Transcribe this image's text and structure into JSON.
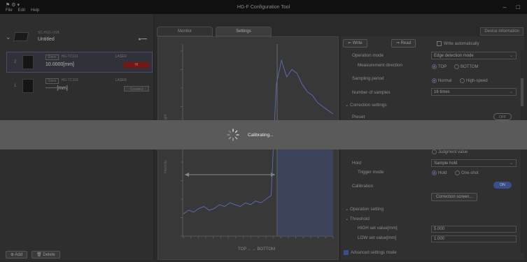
{
  "window": {
    "title": "HG-F Configuration Tool",
    "menu": [
      "File",
      "Edit",
      "Help"
    ],
    "app_icons": "⚑ ⚙ ▾",
    "controls": [
      "–",
      "□"
    ]
  },
  "device": {
    "model": "SC-HG1-USB",
    "name": "Untitled",
    "link_icon": "link-icon"
  },
  "sensors": [
    {
      "index": "2",
      "tag1": "Slave",
      "tag2": "HG-TC113",
      "value": "10.0000[mm]",
      "laser_label": "LASER",
      "status": "HI",
      "selected": true
    },
    {
      "index": "1",
      "tag1": "Slave",
      "tag2": "HG-TC103",
      "value": "-------[mm]",
      "laser_label": "LASER",
      "status": "Connect",
      "selected": false
    }
  ],
  "left_buttons": {
    "add": "Add",
    "delete": "Delete"
  },
  "tabs": [
    "Monitor",
    "Settings"
  ],
  "device_info": "Device information",
  "chart_data": {
    "type": "line",
    "ylabel": "Intensity",
    "ylabel_top": "Height",
    "xlabel": "TOP ←→ BOTTOM",
    "series": [
      {
        "name": "",
        "values": [
          0.12,
          0.14,
          0.13,
          0.15,
          0.16,
          0.14,
          0.15,
          0.17,
          0.16,
          0.18,
          0.17,
          0.16,
          0.18,
          0.17,
          0.19,
          0.18,
          0.2,
          0.22,
          0.82,
          0.95,
          0.86,
          0.9,
          0.88,
          0.82,
          0.78,
          0.76,
          0.72,
          0.7,
          0.68,
          0.66
        ]
      }
    ]
  },
  "settings": {
    "write": "Write",
    "read": "Read",
    "write_auto": "Write automatically",
    "operation_mode_label": "Operation mode",
    "operation_mode_value": "Edge detection mode",
    "measurement_direction_label": "Measurement direction",
    "dir_top": "TOP",
    "dir_bottom": "BOTTOM",
    "sampling_period_label": "Sampling period",
    "sp_normal": "Normal",
    "sp_high": "High-speed",
    "num_samples_label": "Number of samples",
    "num_samples_value": "16 times",
    "correction_settings": "Correction settings",
    "preset_label": "Preset",
    "preset_toggle": "OFF",
    "judgment_value": "Judgment value",
    "hold_label": "Hold",
    "hold_value": "Sample hold",
    "trigger_mode_label": "Trigger mode",
    "tm_hold": "Hold",
    "tm_oneshot": "One-shot",
    "calibration_label": "Calibration",
    "calibration_toggle": "ON",
    "correction_screen": "Correction screen...",
    "operation_setting": "Operation setting",
    "threshold": "Threshold",
    "high_label": "HIGH set value[mm]",
    "high_value": "5.000",
    "low_label": "LOW set value[mm]",
    "low_value": "1.000",
    "advanced_mode": "Advanced settings mode"
  },
  "overlay": {
    "message": "Calibrating..."
  }
}
